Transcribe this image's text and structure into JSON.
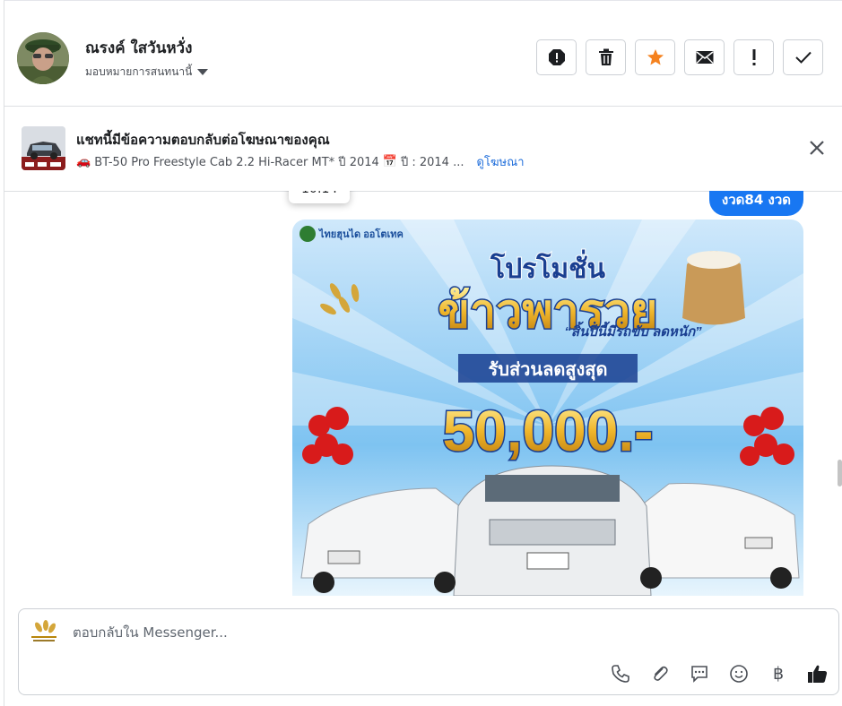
{
  "contact": {
    "name": "ณรงค์ ใสวันหวั่ง",
    "assign_label": "มอบหมายการสนทนานี้"
  },
  "actions": [
    "spam-icon",
    "trash-icon",
    "star-icon",
    "mail-icon",
    "exclaim-icon",
    "check-icon"
  ],
  "ad": {
    "title": "แชทนี้มีข้อความตอบกลับต่อโฆษณาของคุณ",
    "subtitle": "BT-50 Pro Freestyle Cab 2.2 Hi-Racer MT* ปี 2014",
    "year_label": "ปี : 2014 ...",
    "link": "ดูโฆษณา"
  },
  "conversation": {
    "last_message": "งวด84 งวด",
    "tooltip_time": "10:14",
    "image": {
      "headline": "โปรโมชั่น",
      "big_title": "ข้าวพารวย",
      "slogan": "“สิ้นปีนี้มีรถขับ ลดหนัก”",
      "banner": "รับส่วนลดสูงสุด",
      "amount": "50,000.-",
      "brand": "ไทยฮุนได ออโตเทค"
    }
  },
  "composer": {
    "placeholder": "ตอบกลับใน Messenger...",
    "tools": [
      "phone-icon",
      "paperclip-icon",
      "chat-icon",
      "emoji-icon",
      "baht-icon",
      "like-icon"
    ]
  },
  "colors": {
    "accent": "#1877f2",
    "star": "#f5821f"
  }
}
